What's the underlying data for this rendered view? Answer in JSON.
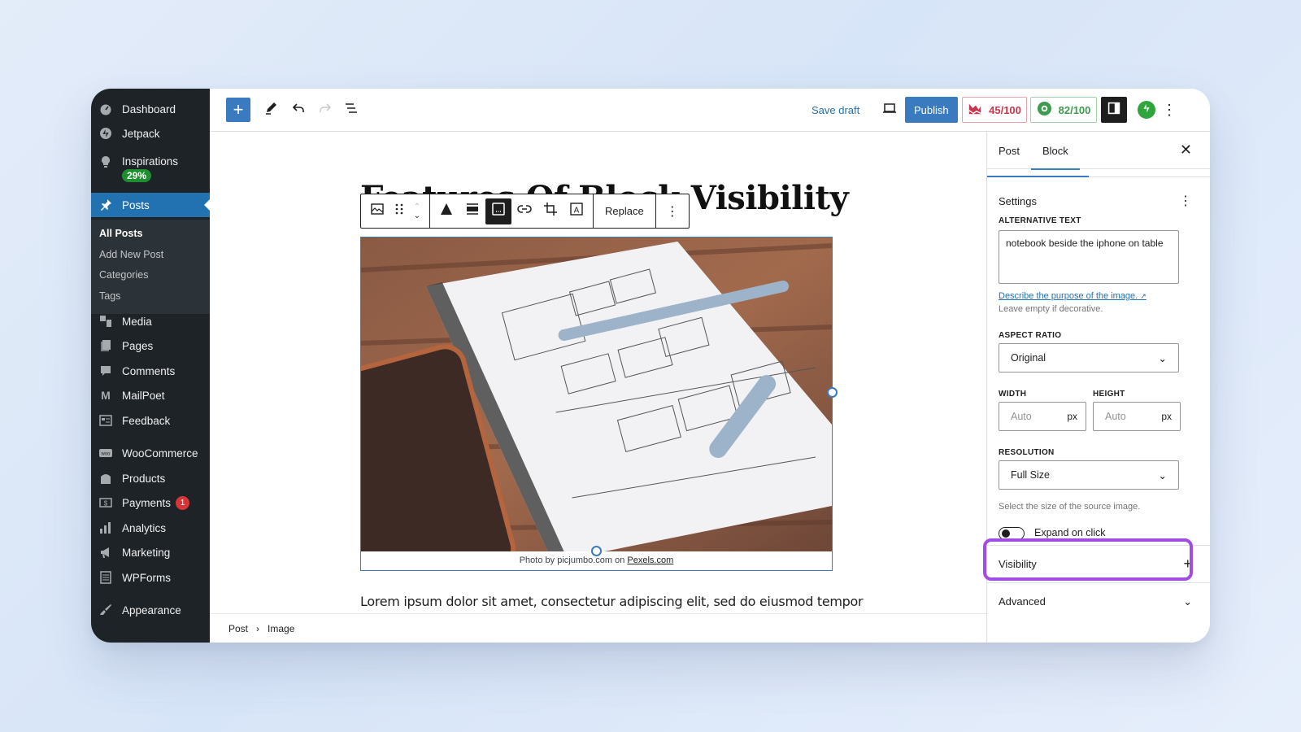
{
  "sidebar": {
    "items": [
      {
        "label": "Dashboard",
        "icon": "dashboard-icon"
      },
      {
        "label": "Jetpack",
        "icon": "jetpack-icon"
      },
      {
        "label": "Inspirations",
        "icon": "lightbulb-icon",
        "badge": "29%"
      },
      {
        "label": "Posts",
        "icon": "pin-icon",
        "active": true
      },
      {
        "label": "Media",
        "icon": "media-icon"
      },
      {
        "label": "Pages",
        "icon": "pages-icon"
      },
      {
        "label": "Comments",
        "icon": "comment-icon"
      },
      {
        "label": "MailPoet",
        "icon": "mailpoet-icon"
      },
      {
        "label": "Feedback",
        "icon": "feedback-icon"
      },
      {
        "label": "WooCommerce",
        "icon": "woo-icon"
      },
      {
        "label": "Products",
        "icon": "products-icon"
      },
      {
        "label": "Payments",
        "icon": "payments-icon",
        "badge": "1"
      },
      {
        "label": "Analytics",
        "icon": "analytics-icon"
      },
      {
        "label": "Marketing",
        "icon": "megaphone-icon"
      },
      {
        "label": "WPForms",
        "icon": "forms-icon"
      },
      {
        "label": "Appearance",
        "icon": "brush-icon"
      }
    ],
    "submenu": [
      "All Posts",
      "Add New Post",
      "Categories",
      "Tags"
    ]
  },
  "topbar": {
    "save_draft": "Save draft",
    "publish": "Publish",
    "seo_score": "45/100",
    "readability_score": "82/100"
  },
  "editor": {
    "title": "Features Of Block Visibility",
    "toolbar": {
      "replace": "Replace"
    },
    "caption_text": "Photo by picjumbo.com on ",
    "caption_link": "Pexels.com",
    "paragraph": "Lorem ipsum dolor sit amet, consectetur adipiscing elit, sed do eiusmod tempor"
  },
  "breadcrumbs": [
    "Post",
    "Image"
  ],
  "panel": {
    "tabs": [
      "Post",
      "Block"
    ],
    "active_tab": "Block",
    "settings_title": "Settings",
    "alt_text_label": "ALTERNATIVE TEXT",
    "alt_text_value": "notebook beside the iphone on table",
    "alt_help_link": "Describe the purpose of the image.",
    "alt_help": "Leave empty if decorative.",
    "aspect_ratio_label": "ASPECT RATIO",
    "aspect_ratio_value": "Original",
    "width_label": "WIDTH",
    "height_label": "HEIGHT",
    "width_placeholder": "Auto",
    "height_placeholder": "Auto",
    "unit": "px",
    "resolution_label": "RESOLUTION",
    "resolution_value": "Full Size",
    "resolution_help": "Select the size of the source image.",
    "expand_label": "Expand on click",
    "expand_on": false,
    "visibility": "Visibility",
    "advanced": "Advanced"
  },
  "colors": {
    "accent": "#3a7bbf",
    "highlight": "#a24de2",
    "seo_red": "#c8364b",
    "readability_green": "#3d9a4f"
  }
}
